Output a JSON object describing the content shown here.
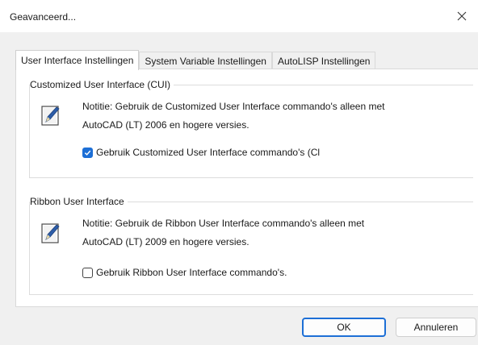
{
  "window": {
    "title": "Geavanceerd..."
  },
  "tabs": [
    {
      "label": "User Interface Instellingen",
      "active": true
    },
    {
      "label": "System Variable Instellingen",
      "active": false
    },
    {
      "label": "AutoLISP Instellingen",
      "active": false
    }
  ],
  "cui_group": {
    "legend": "Customized User Interface (CUI)",
    "note_line1": "Notitie: Gebruik de Customized User Interface commando's alleen met",
    "note_line2": "AutoCAD (LT) 2006 en hogere versies.",
    "checkbox_label": "Gebruik Customized User Interface commando's (Cl",
    "checked": true
  },
  "ribbon_group": {
    "legend": "Ribbon User Interface",
    "note_line1": "Notitie: Gebruik de Ribbon User Interface commando's alleen met",
    "note_line2": "AutoCAD (LT) 2009 en hogere versies.",
    "checkbox_label": "Gebruik Ribbon User Interface commando's.",
    "checked": false
  },
  "buttons": {
    "ok": "OK",
    "cancel": "Annuleren"
  },
  "colors": {
    "accent": "#1d6fd6",
    "dialog_bg": "#f0f0f0",
    "panel_bg": "#ffffff"
  },
  "icons": {
    "close": "close-icon",
    "note": "notepad-icon",
    "check": "checkmark-icon"
  }
}
